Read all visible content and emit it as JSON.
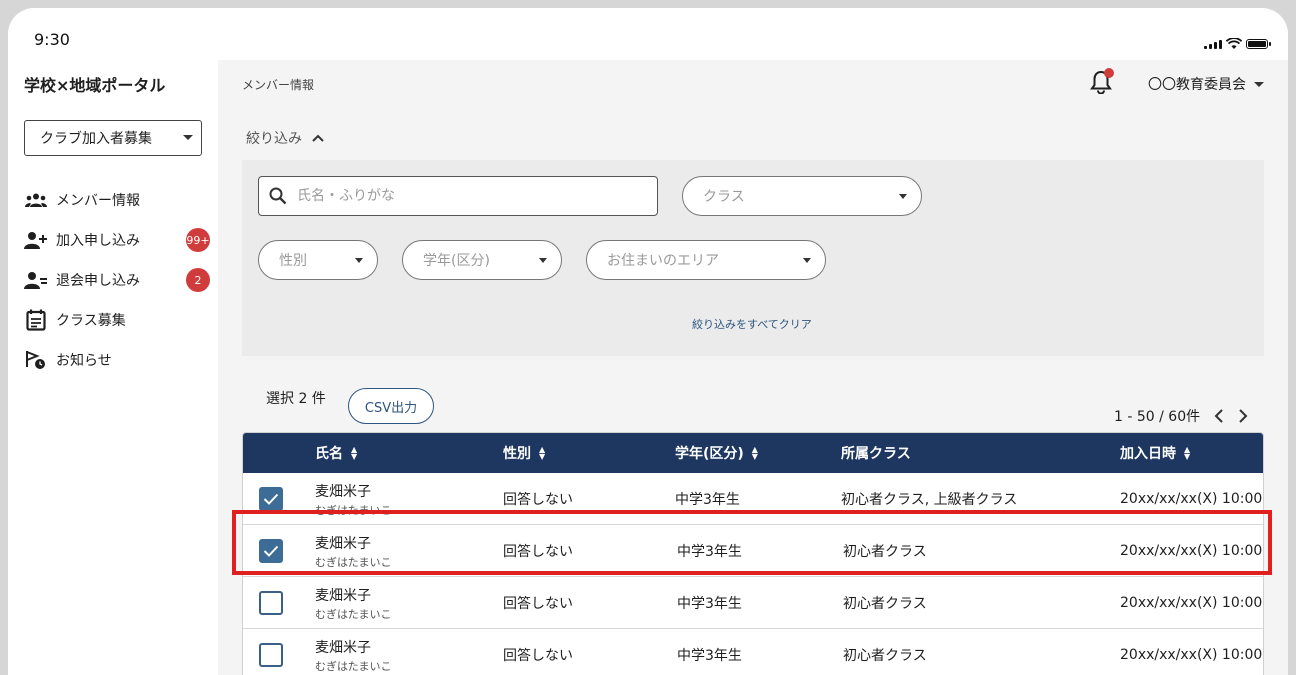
{
  "status_bar": {
    "time": "9:30"
  },
  "sidebar": {
    "app_title": "学校×地域ポータル",
    "club_select": "クラブ加入者募集",
    "items": [
      {
        "label": "メンバー情報",
        "icon": "members-icon",
        "badge": ""
      },
      {
        "label": "加入申し込み",
        "icon": "person-add-icon",
        "badge": "99+"
      },
      {
        "label": "退会申し込み",
        "icon": "person-remove-icon",
        "badge": "2"
      },
      {
        "label": "クラス募集",
        "icon": "calendar-list-icon",
        "badge": ""
      },
      {
        "label": "お知らせ",
        "icon": "announcement-icon",
        "badge": ""
      }
    ]
  },
  "header": {
    "breadcrumb": "メンバー情報",
    "org_name": "〇〇教育委員会"
  },
  "filters": {
    "toggle_label": "絞り込み",
    "search_placeholder": "氏名・ふりがな",
    "class_placeholder": "クラス",
    "gender_placeholder": "性別",
    "grade_placeholder": "学年(区分)",
    "area_placeholder": "お住まいのエリア",
    "clear_label": "絞り込みをすべてクリア"
  },
  "selection": {
    "selected_label": "選択 2 件",
    "csv_label": "CSV出力",
    "pager_label": "1 - 50 / 60件"
  },
  "table": {
    "columns": [
      "氏名",
      "性別",
      "学年(区分)",
      "所属クラス",
      "加入日時"
    ],
    "rows": [
      {
        "checked": true,
        "name": "麦畑米子",
        "kana": "むぎはたまいこ",
        "gender": "回答しない",
        "grade": "中学3年生",
        "classes": "初心者クラス, 上級者クラス",
        "joined": "20xx/xx/xx(X) 10:00"
      },
      {
        "checked": true,
        "name": "麦畑米子",
        "kana": "むぎはたまいこ",
        "gender": "回答しない",
        "grade": "中学3年生",
        "classes": "初心者クラス",
        "joined": "20xx/xx/xx(X) 10:00"
      },
      {
        "checked": false,
        "name": "麦畑米子",
        "kana": "むぎはたまいこ",
        "gender": "回答しない",
        "grade": "中学3年生",
        "classes": "初心者クラス",
        "joined": "20xx/xx/xx(X) 10:00"
      },
      {
        "checked": false,
        "name": "麦畑米子",
        "kana": "むぎはたまいこ",
        "gender": "回答しない",
        "grade": "中学3年生",
        "classes": "初心者クラス",
        "joined": "20xx/xx/xx(X) 10:00"
      }
    ]
  },
  "colors": {
    "header_navy": "#1d3760",
    "accent_blue": "#3d6d97",
    "badge_red": "#d03c3c",
    "highlight_red": "#e0201f"
  }
}
